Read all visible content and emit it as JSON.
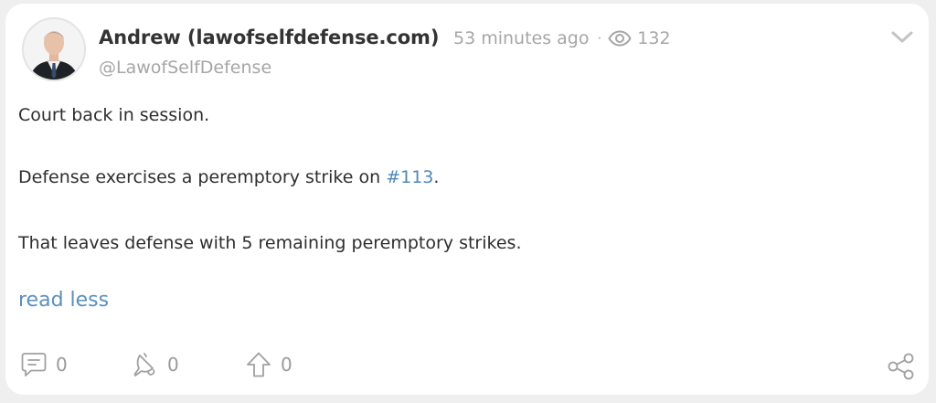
{
  "post": {
    "author_name": "Andrew (lawofselfdefense.com)",
    "handle": "@LawofSelfDefense",
    "timestamp": "53 minutes ago",
    "separator": "·",
    "views": "132",
    "body": {
      "line1": "Court back in session.",
      "line2_prefix": "Defense exercises a peremptory strike on ",
      "line2_hashtag": "#113",
      "line2_suffix": ".",
      "line3": "That leaves defense with 5 remaining peremptory strikes."
    },
    "read_less_label": "read less"
  },
  "actions": {
    "comments": "0",
    "tips": "0",
    "upvotes": "0"
  },
  "icons": {
    "avatar": "author-avatar",
    "views": "eye-icon",
    "menu": "chevron-down-icon",
    "comment": "comment-icon",
    "tip": "tip-bell-icon",
    "upvote": "upvote-arrow-icon",
    "share": "share-icon"
  },
  "colors": {
    "card_bg": "#ffffff",
    "page_bg": "#efefef",
    "text": "#2e2e2e",
    "muted": "#a6a6a6",
    "link": "#5b8fbf"
  }
}
